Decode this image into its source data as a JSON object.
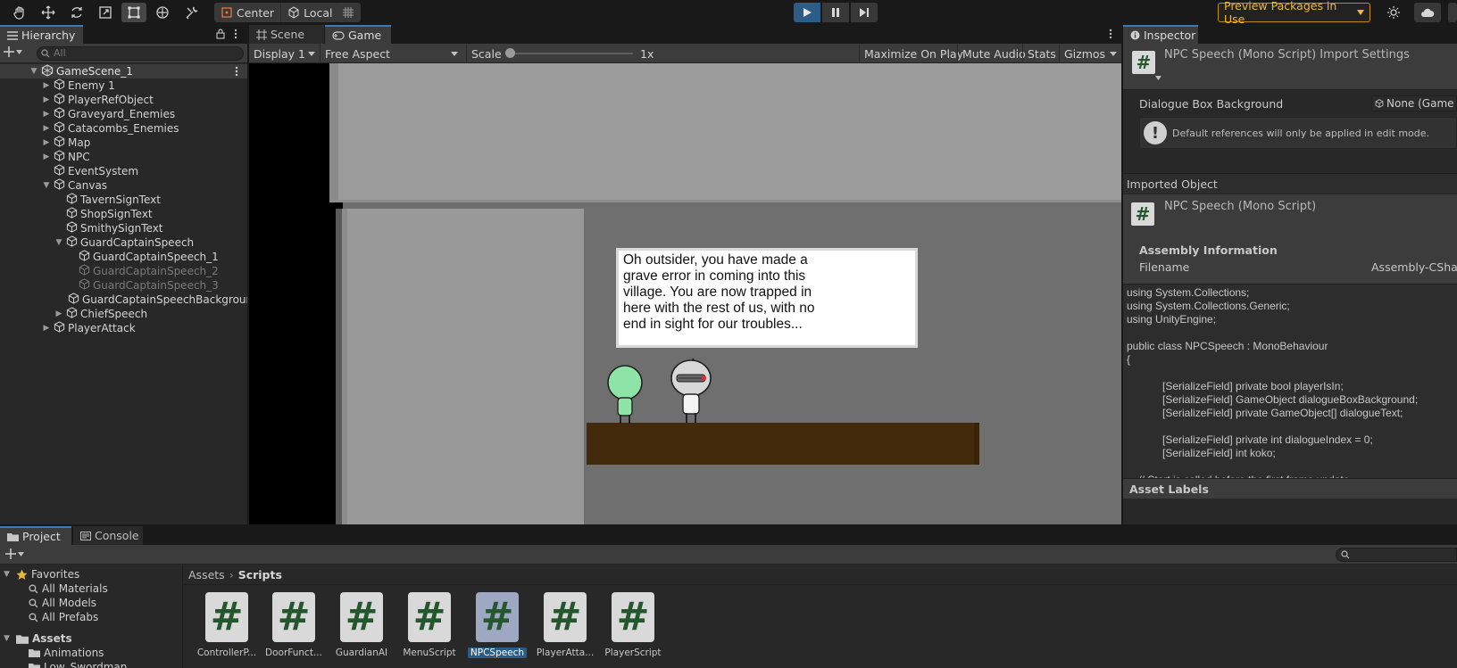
{
  "toolbar": {
    "pivot_center": "Center",
    "pivot_local": "Local",
    "preview_packages": "Preview Packages in Use"
  },
  "hierarchy": {
    "tab": "Hierarchy",
    "search_placeholder": "All",
    "scene": "GameScene_1",
    "items": [
      "Enemy 1",
      "PlayerRefObject",
      "Graveyard_Enemies",
      "Catacombs_Enemies",
      "Map",
      "NPC",
      "EventSystem",
      "Canvas",
      "TavernSignText",
      "ShopSignText",
      "SmithySignText",
      "GuardCaptainSpeech",
      "GuardCaptainSpeech_1",
      "GuardCaptainSpeech_2",
      "GuardCaptainSpeech_3",
      "GuardCaptainSpeechBackground",
      "ChiefSpeech",
      "PlayerAttack"
    ]
  },
  "game": {
    "tab_scene": "Scene",
    "tab_game": "Game",
    "display": "Display 1",
    "aspect": "Free Aspect",
    "scale_label": "Scale",
    "scale_value": "1x",
    "maximize": "Maximize On Play",
    "mute": "Mute Audio",
    "stats": "Stats",
    "gizmos": "Gizmos",
    "dialogue_text": "Oh outsider, you have made a\ngrave error in coming into this\nvillage. You are now trapped in\nhere with the rest of us, with no\nend in sight for our troubles..."
  },
  "inspector": {
    "tab": "Inspector",
    "title": "NPC Speech (Mono Script) Import Settings",
    "field_label": "Dialogue Box Background",
    "field_value": "None (Game O",
    "help_text": "Default references will only be applied in edit mode.",
    "imported_object_header": "Imported Object",
    "imported_object_name": "NPC Speech (Mono Script)",
    "assembly_header": "Assembly Information",
    "filename_label": "Filename",
    "filename_value": "Assembly-CShar",
    "code": [
      "using System.Collections;",
      "using System.Collections.Generic;",
      "using UnityEngine;",
      "",
      "public class NPCSpeech : MonoBehaviour",
      "{",
      "",
      "            [SerializeField] private bool playerIsIn;",
      "            [SerializeField] GameObject dialogueBoxBackground;",
      "            [SerializeField] private GameObject[] dialogueText;",
      "",
      "            [SerializeField] private int dialogueIndex = 0;",
      "            [SerializeField] int koko;",
      "",
      "    // Start is called before the first frame update"
    ],
    "asset_labels": "Asset Labels"
  },
  "project": {
    "tab_project": "Project",
    "tab_console": "Console",
    "favorites": "Favorites",
    "fav_items": [
      "All Materials",
      "All Models",
      "All Prefabs"
    ],
    "assets": "Assets",
    "asset_folders": [
      "Animations",
      "Low_Swordman"
    ],
    "breadcrumb_root": "Assets",
    "breadcrumb_current": "Scripts",
    "files": [
      "ControllerP...",
      "DoorFunct...",
      "GuardianAI",
      "MenuScript",
      "NPCSpeech",
      "PlayerAtta...",
      "PlayerScript"
    ],
    "selected_file_index": 4
  }
}
